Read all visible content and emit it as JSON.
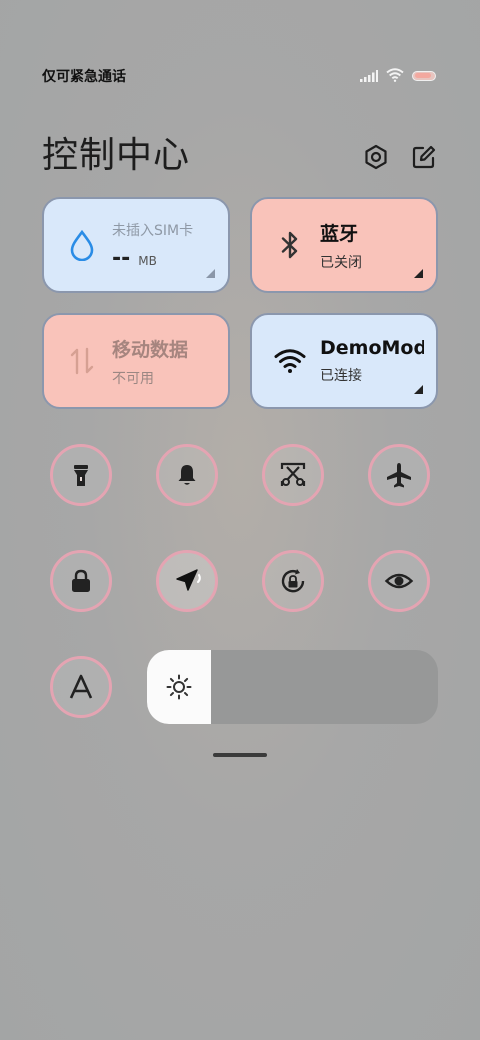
{
  "status": {
    "carrier_text": "仅可紧急通话",
    "icons": [
      "signal-icon",
      "wifi-icon",
      "battery-icon"
    ]
  },
  "header": {
    "title": "控制中心",
    "icons": [
      "settings-icon",
      "edit-icon"
    ]
  },
  "tiles": {
    "data_usage": {
      "title": "未插入SIM卡",
      "value": "--",
      "unit": "MB",
      "icon": "water-drop-icon",
      "color": "#d9e8fa"
    },
    "bluetooth": {
      "title": "蓝牙",
      "status": "已关闭",
      "icon": "bluetooth-icon",
      "color": "#f9c3ba"
    },
    "mobile_data": {
      "title": "移动数据",
      "status": "不可用",
      "icon": "data-arrows-icon",
      "color": "#f9c3ba"
    },
    "wifi": {
      "title": "DemoMod",
      "status": "已连接",
      "icon": "wifi-icon",
      "color": "#d9e8fa"
    }
  },
  "toggles": [
    "flashlight-icon",
    "bell-icon",
    "screenshot-icon",
    "airplane-icon",
    "lock-icon",
    "location-icon",
    "rotation-lock-icon",
    "eye-icon",
    "auto-brightness-icon"
  ],
  "brightness": {
    "level": 0.22,
    "icon": "sun-icon"
  },
  "colors": {
    "accent_pink": "#e4a4b2",
    "tile_blue": "#d9e8fa",
    "tile_pink": "#f9c3ba"
  }
}
